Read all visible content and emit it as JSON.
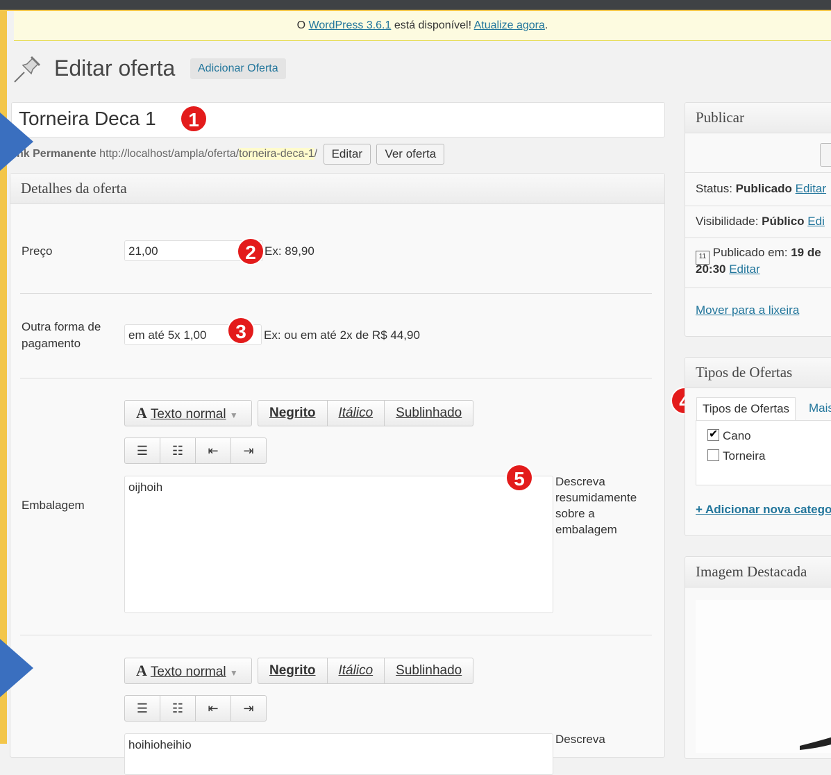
{
  "nag": {
    "prefix": "O",
    "link": "WordPress 3.6.1",
    "middle": "está disponível!",
    "update": "Atualize agora",
    "suffix": "."
  },
  "header": {
    "title": "Editar oferta",
    "add_button": "Adicionar Oferta"
  },
  "post": {
    "title": "Torneira Deca 1",
    "permalink_label": "nk Permanente",
    "permalink_base": "http://localhost/ampla/oferta/",
    "permalink_slug": "torneira-deca-1",
    "permalink_end": "/",
    "edit_button": "Editar",
    "view_button": "Ver oferta"
  },
  "details": {
    "title": "Detalhes da oferta",
    "price": {
      "label": "Preço",
      "value": "21,00",
      "hint": "Ex: 89,90"
    },
    "payment": {
      "label_1": "Outra forma de",
      "label_2": "pagamento",
      "value": "em até 5x 1,00",
      "hint": "Ex: ou em até 2x de R$ 44,90"
    },
    "packaging": {
      "label": "Embalagem",
      "toolbar": {
        "format": "Texto normal",
        "bold": "Negrito",
        "italic": "Itálico",
        "underline": "Sublinhado"
      },
      "value": "oijhoih",
      "hint_lines": [
        "Descreva",
        "resumidamente",
        "sobre a",
        "embalagem"
      ]
    },
    "second_editor": {
      "toolbar": {
        "format": "Texto normal",
        "bold": "Negrito",
        "italic": "Itálico",
        "underline": "Sublinhado"
      },
      "value": "hoihioheihio",
      "hint": "Descreva"
    }
  },
  "markers": [
    "1",
    "2",
    "3",
    "4",
    "5"
  ],
  "publish": {
    "title": "Publicar",
    "status_label": "Status:",
    "status_value": "Publicado",
    "status_edit": "Editar",
    "visibility_label": "Visibilidade:",
    "visibility_value": "Público",
    "visibility_edit": "Edi",
    "published_label": "Publicado em:",
    "published_date": "19 de",
    "published_time": "20:30",
    "published_edit": "Editar",
    "trash": "Mover para a lixeira"
  },
  "offer_types": {
    "title": "Tipos de Ofertas",
    "tab_all": "Tipos de Ofertas",
    "tab_popular": "Mais",
    "items": [
      {
        "label": "Cano",
        "checked": true
      },
      {
        "label": "Torneira",
        "checked": false
      }
    ],
    "add_new": "+ Adicionar nova catego"
  },
  "featured_image": {
    "title": "Imagem Destacada"
  }
}
